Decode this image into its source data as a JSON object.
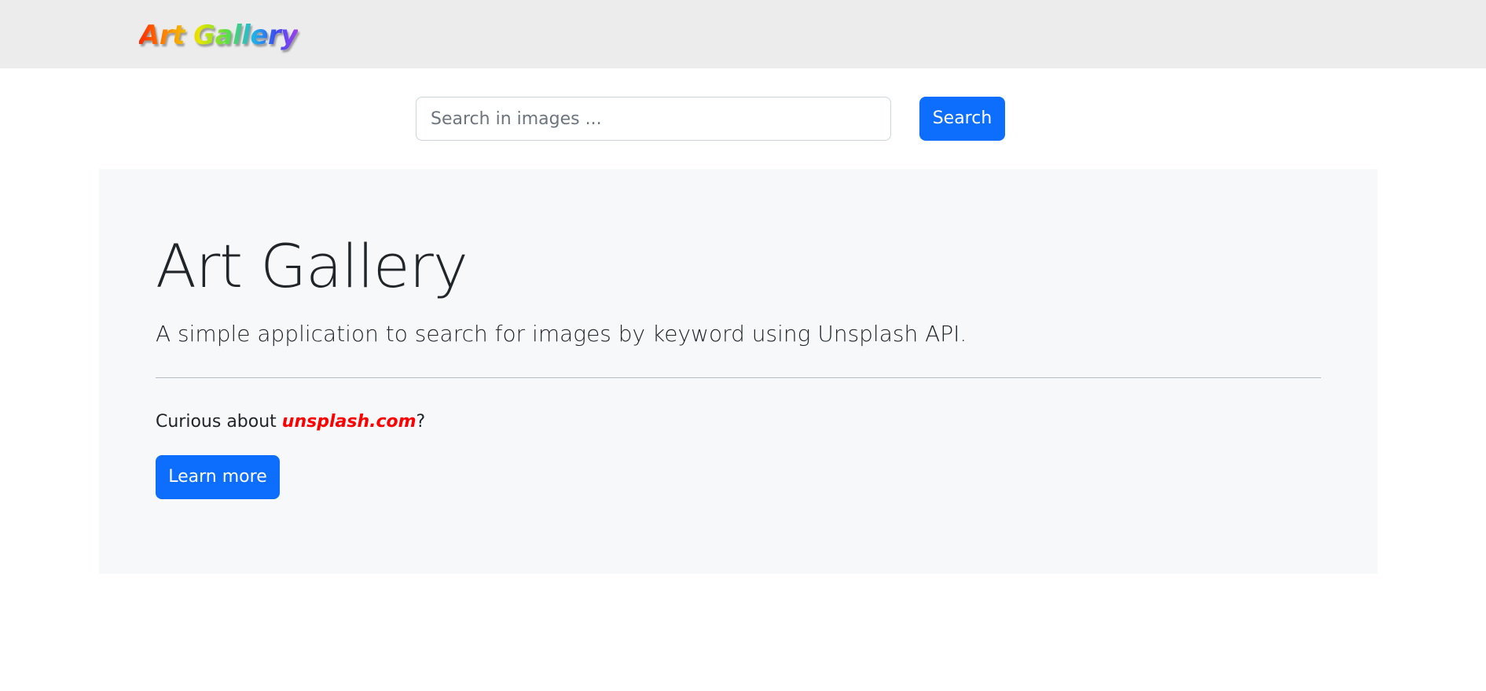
{
  "navbar": {
    "brand": "Art Gallery"
  },
  "search": {
    "placeholder": "Search in images ...",
    "value": "",
    "button_label": "Search"
  },
  "jumbotron": {
    "title": "Art Gallery",
    "lead": "A simple application to search for images by keyword using Unsplash API.",
    "curious_prefix": "Curious about ",
    "curious_link": "unsplash.com",
    "curious_suffix": "?",
    "button_label": "Learn more"
  },
  "colors": {
    "primary": "#0d6efd",
    "navbar_bg": "#ececed",
    "jumbotron_bg": "#f7f8fa",
    "link": "#ff0000"
  }
}
